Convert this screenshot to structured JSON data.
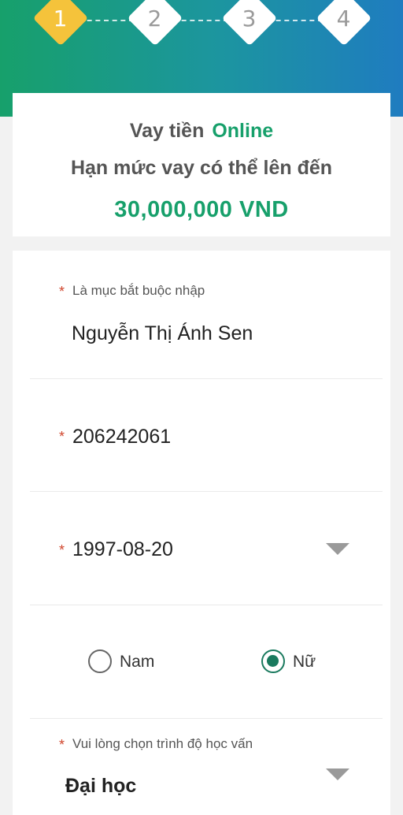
{
  "steps": [
    "1",
    "2",
    "3",
    "4"
  ],
  "header": {
    "title_prefix": "Vay tiền",
    "title_accent": "Online",
    "subtitle": "Hạn mức vay có thể lên đến",
    "amount": "30,000,000 VND"
  },
  "form": {
    "required_note": "Là mục bắt buộc nhập",
    "required_mark": "*",
    "full_name": "Nguyễn Thị Ánh Sen",
    "id_number": "206242061",
    "birth_date": "1997-08-20",
    "gender": {
      "options": [
        "Nam",
        "Nữ"
      ],
      "selected": "Nữ"
    },
    "education_label": "Vui lòng chọn trình độ học vấn",
    "education_value": "Đại học"
  },
  "colors": {
    "brand_green": "#17a06b",
    "brand_blue": "#1f7cc0",
    "active_step": "#f5c33b",
    "required_red": "#d0452c",
    "radio_checked": "#1a7a5e"
  }
}
